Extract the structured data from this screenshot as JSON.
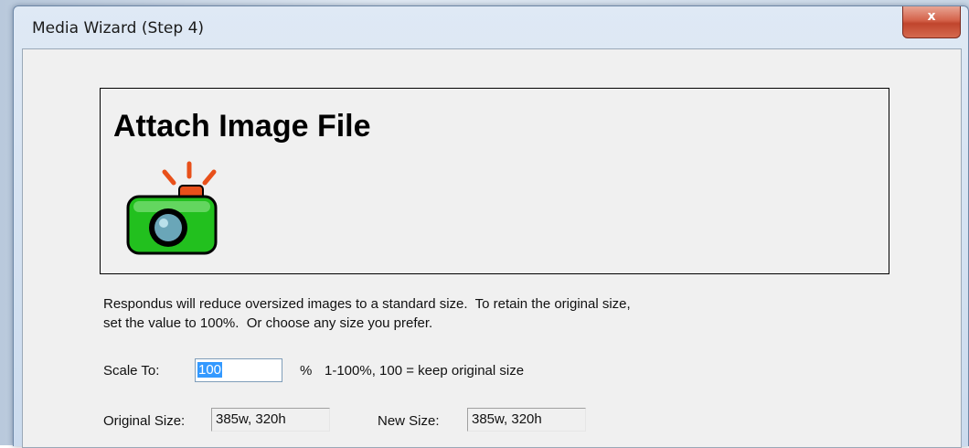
{
  "window": {
    "title": "Media Wizard (Step 4)",
    "close_glyph": "x"
  },
  "header": {
    "title": "Attach Image File",
    "icon": "camera-icon"
  },
  "description": {
    "line1": "Respondus will reduce oversized images to a standard size.  To retain the original size,",
    "line2": "set the value to 100%.  Or choose any size you prefer."
  },
  "scale": {
    "label": "Scale To:",
    "value": "100",
    "unit": "%",
    "hint": "1-100%, 100 = keep original size"
  },
  "sizes": {
    "original_label": "Original Size:",
    "original_value": "385w, 320h",
    "new_label": "New Size:",
    "new_value": "385w, 320h"
  },
  "colors": {
    "camera_body": "#22c01e",
    "camera_flash": "#e8501a",
    "camera_lens": "#6aa6b8"
  }
}
